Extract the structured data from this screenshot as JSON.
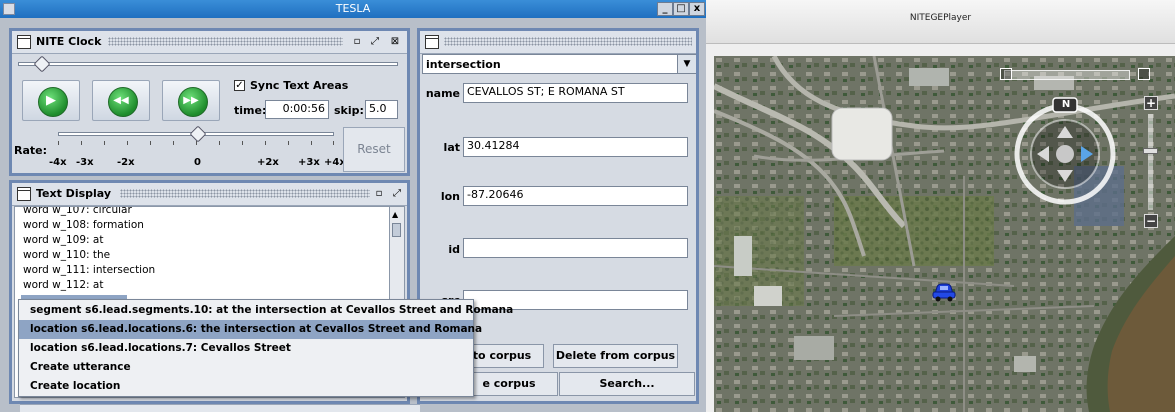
{
  "tesla": {
    "title": "TESLA",
    "buttons": {
      "minimize": "_",
      "maximize": "□",
      "close": "x"
    }
  },
  "clock": {
    "title": "NITE Clock",
    "sync_label": "Sync Text Areas",
    "sync_checked": true,
    "checkmark": "✓",
    "time_label": "time:",
    "time_value": "0:00:56",
    "skip_label": "skip:",
    "skip_value": "5.0",
    "rate_label": "Rate:",
    "rate_ticks": [
      "-4x",
      "-3x",
      "-2x",
      "0",
      "+2x",
      "+3x",
      "+4x"
    ],
    "reset_label": "Reset",
    "play_icons": [
      "play-forward-icon",
      "rewind-icon",
      "fast-forward-icon"
    ],
    "glyphs": {
      "play": "▶",
      "rewind": "◀◀",
      "fast_forward": "▶▶"
    },
    "title_icons": {
      "iconify": "▫",
      "maximize": "⤢",
      "close": "⊠"
    }
  },
  "text_display": {
    "title": "Text Display",
    "lines": [
      "word w_107: circular",
      "word w_108: formation",
      "word w_109: at",
      "word w_110: the",
      "word w_111: intersection",
      "word w_112: at"
    ]
  },
  "popup_menu": {
    "items": [
      "segment s6.lead.segments.10: at the intersection at Cevallos Street and Romana",
      "location s6.lead.locations.6: the intersection at Cevallos Street and Romana",
      "location s6.lead.locations.7: Cevallos Street",
      "Create utterance",
      "Create location"
    ],
    "selected_index": 1
  },
  "annotation": {
    "type_selected": "intersection",
    "fields": [
      {
        "label": "name",
        "value": "CEVALLOS ST; E ROMANA ST"
      },
      {
        "label": "lat",
        "value": "30.41284"
      },
      {
        "label": "lon",
        "value": "-87.20646"
      },
      {
        "label": "id",
        "value": ""
      },
      {
        "label": "src",
        "value": ""
      }
    ],
    "buttons": {
      "add_to_corpus": "to corpus",
      "delete_from_corpus": "Delete from corpus",
      "save_corpus": "e corpus",
      "search": "Search..."
    }
  },
  "player": {
    "title": "NITEGEPlayer",
    "compass_label": "N",
    "zoom_in": "+",
    "zoom_out": "−"
  }
}
